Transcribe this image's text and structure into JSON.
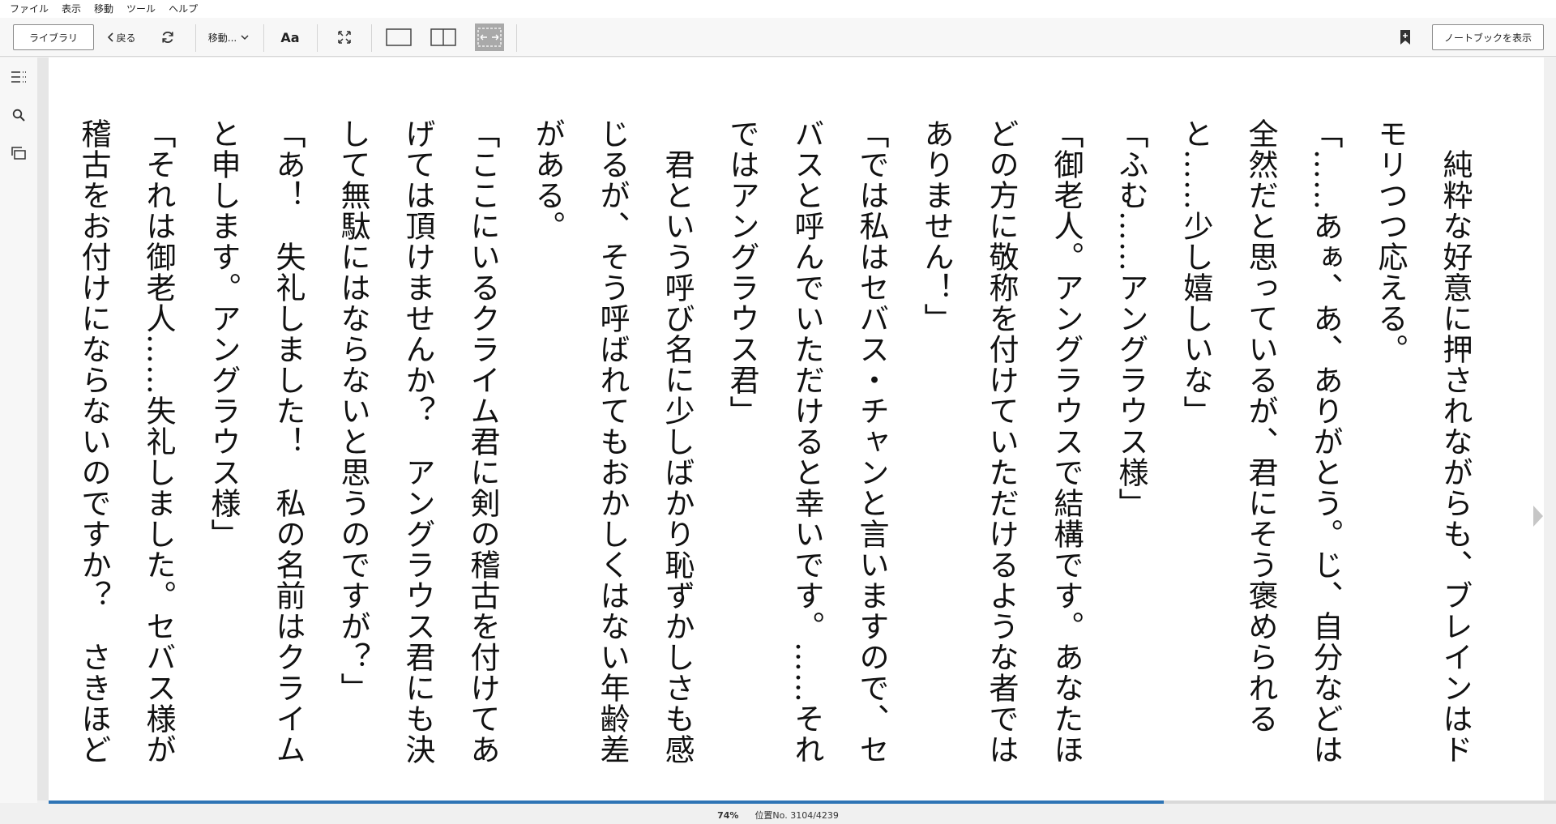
{
  "menu": [
    "ファイル",
    "表示",
    "移動",
    "ツール",
    "ヘルプ"
  ],
  "toolbar": {
    "library_label": "ライブラリ",
    "back_label": "戻る",
    "goto_label": "移動...",
    "font_label": "Aa",
    "notebook_label": "ノートブックを表示"
  },
  "rail_icons": [
    "toc-icon",
    "search-icon",
    "flashcards-icon"
  ],
  "book": {
    "columns": [
      "　純粋な好意に押されながらも、ブレインはド",
      "モリつつ応える。",
      "「……あぁ、あ、ありがとう。じ、自分などは",
      "全然だと思っているが、君にそう褒められる",
      "と……少し嬉しいな」",
      "「ふむ……アングラウス様」",
      "「御老人。アングラウスで結構です。あなたほ",
      "どの方に敬称を付けていただけるような者では",
      "ありません！」",
      "「では私はセバス・チャンと言いますので、セ",
      "バスと呼んでいただけると幸いです。……それ",
      "ではアングラウス君」",
      "　君という呼び名に少しばかり恥ずかしさも感",
      "じるが、そう呼ばれてもおかしくはない年齢差",
      "がある。",
      "「ここにいるクライム君に剣の稽古を付けてあ",
      "げては頂けませんか？　アングラウス君にも決",
      "して無駄にはならないと思うのですが？」",
      "「あ！　失礼しました！　私の名前はクライム",
      "と申します。アングラウス様」",
      "「それは御老人……失礼しました。セバス様が",
      "稽古をお付けにならないのですか？　さきほど"
    ]
  },
  "status": {
    "percent": "74%",
    "location": "位置No. 3104/4239",
    "progress_fraction": 0.74
  },
  "colors": {
    "progress": "#2e74b5"
  }
}
